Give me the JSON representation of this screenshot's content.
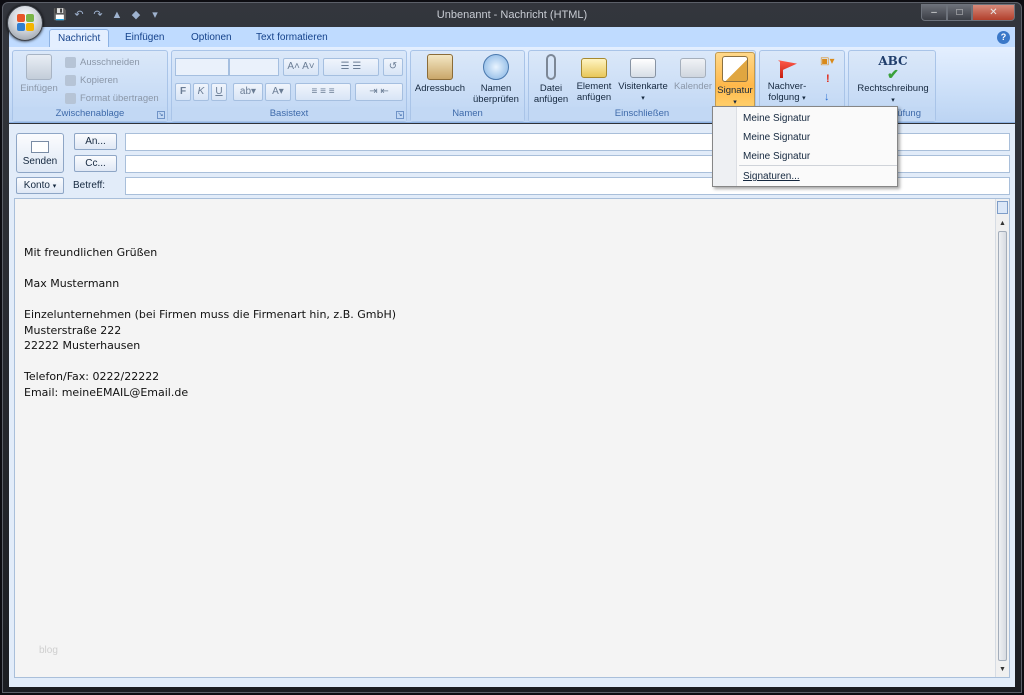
{
  "window": {
    "title": "Unbenannt - Nachricht (HTML)",
    "buttons": {
      "minimize": "–",
      "maximize": "□",
      "close": "✕"
    }
  },
  "ribbon": {
    "tabs": [
      {
        "label": "Nachricht",
        "active": true
      },
      {
        "label": "Einfügen",
        "active": false
      },
      {
        "label": "Optionen",
        "active": false
      },
      {
        "label": "Text formatieren",
        "active": false
      }
    ],
    "help": "?",
    "groups": {
      "clipboard": {
        "label": "Zwischenablage",
        "paste": "Einfügen",
        "cut": "Ausschneiden",
        "copy": "Kopieren",
        "format_painter": "Format übertragen"
      },
      "basictext": {
        "label": "Basistext",
        "bold": "F",
        "italic": "K",
        "underline": "U"
      },
      "names": {
        "label": "Namen",
        "addressbook": "Adressbuch",
        "check_names_1": "Namen",
        "check_names_2": "überprüfen"
      },
      "include": {
        "label": "Einschließen",
        "attach_file_1": "Datei",
        "attach_file_2": "anfügen",
        "attach_item_1": "Element",
        "attach_item_2": "anfügen",
        "business_card": "Visitenkarte",
        "calendar": "Kalender",
        "signature": "Signatur"
      },
      "options": {
        "followup_1": "Nachver-",
        "followup_2": "folgung"
      },
      "proofing": {
        "label": "prüfung",
        "spelling": "Rechtschreibung",
        "abc": "ABC"
      }
    }
  },
  "header": {
    "send": "Senden",
    "to": "An...",
    "cc": "Cc...",
    "account": "Konto",
    "subject_label": "Betreff:"
  },
  "body": {
    "lines": [
      "Mit freundlichen Grüßen",
      "",
      "Max Mustermann",
      "",
      "Einzelunternehmen (bei Firmen muss die Firmenart hin, z.B. GmbH)",
      "Musterstraße 222",
      "22222 Musterhausen",
      "",
      "Telefon/Fax: 0222/22222",
      "Email: meineEMAIL@Email.de"
    ],
    "watermark": "blog"
  },
  "signature_menu": {
    "items": [
      "Meine Signatur",
      "Meine Signatur",
      "Meine Signatur"
    ],
    "manage": "Signaturen..."
  },
  "colors": {
    "ribbon_bg": "#c7dcf7",
    "active_button": "#ffb84a",
    "title_bar": "#1b1d22",
    "accent": "#15428b"
  }
}
